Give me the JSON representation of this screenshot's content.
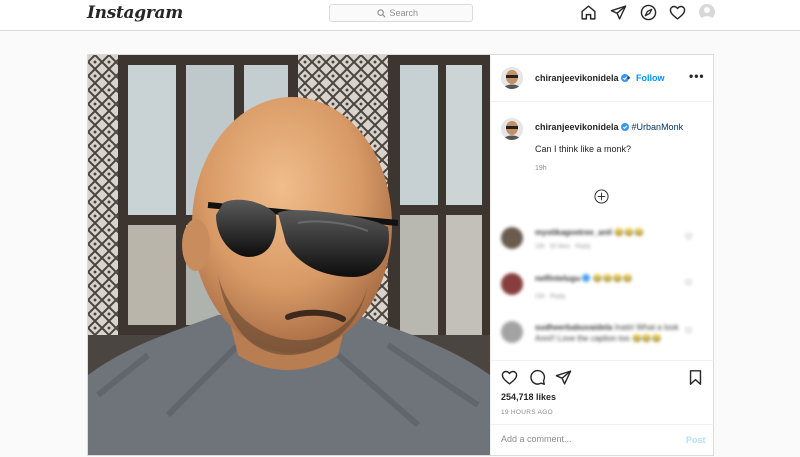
{
  "header": {
    "logo": "Instagram",
    "search_placeholder": "Search",
    "icons": [
      "home-icon",
      "direct-icon",
      "explore-icon",
      "activity-icon",
      "profile-avatar"
    ]
  },
  "post": {
    "author": {
      "username": "chiranjeevikonidela",
      "verified": true,
      "follow_label": "Follow",
      "separator": "•",
      "more_label": "•••"
    },
    "caption": {
      "username": "chiranjeevikonidela",
      "hashtag": "#UrbanMonk",
      "text": "Can I think like a monk?",
      "time": "19h"
    },
    "comments": [
      {
        "username": "mystikagoetree_anil",
        "text": "",
        "emoji": "😂😂😂",
        "time": "15h",
        "likes": "50 likes",
        "reply": "Reply"
      },
      {
        "username": "nelfintelugu",
        "text": "",
        "emoji": "😂😂😂😂",
        "time": "15h",
        "likes": "",
        "reply": "Reply"
      },
      {
        "username": "sudheerbabuvaidela",
        "text": "Inatiri What a look Anni!! Love the caption too",
        "emoji": "😂😂😂",
        "time": "",
        "likes": "",
        "reply": ""
      }
    ],
    "likes": "254,718 likes",
    "timestamp": "19 HOURS AGO",
    "comment_placeholder": "Add a comment...",
    "post_label": "Post"
  },
  "colors": {
    "accent": "#0095f6",
    "border": "#dbdbdb",
    "muted_text": "#8e8e8e",
    "post_disabled": "#b2dffc"
  }
}
